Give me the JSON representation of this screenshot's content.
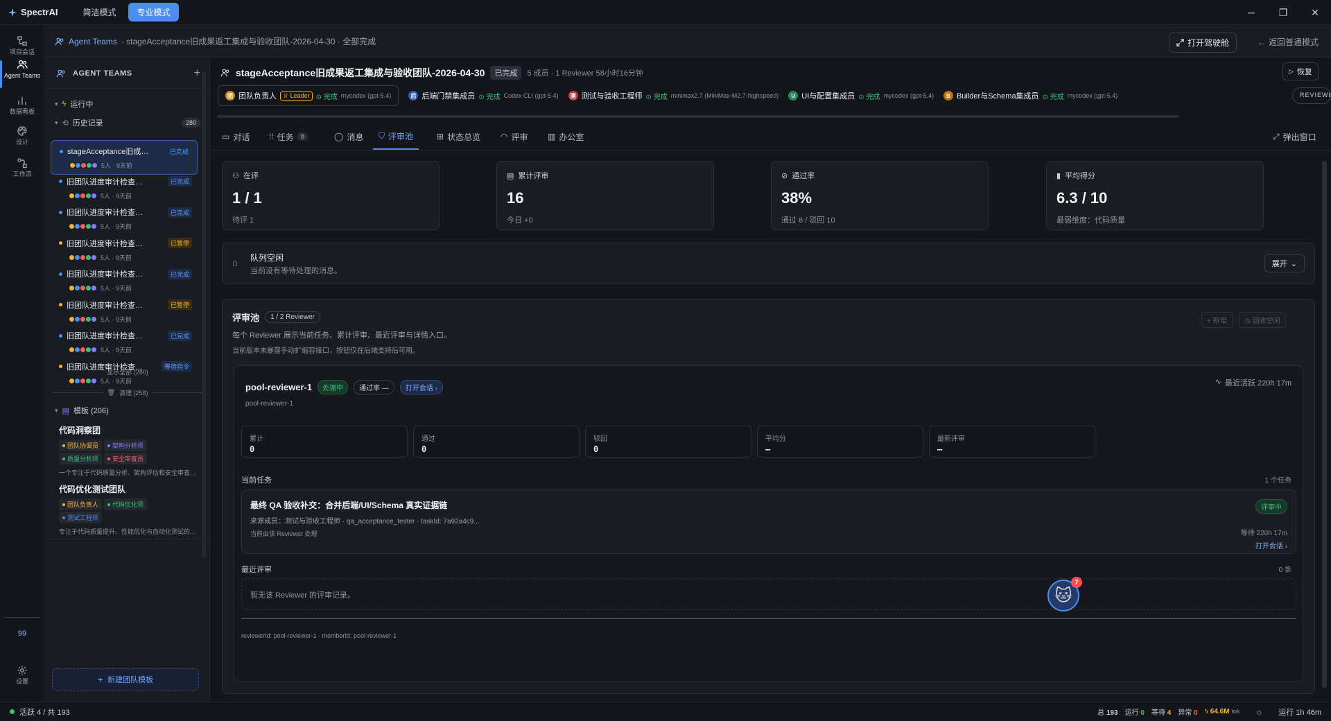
{
  "app": {
    "name": "SpectrAI",
    "modes": [
      "简洁模式",
      "专业模式"
    ]
  },
  "window": {
    "minimize": "─",
    "restore": "❐",
    "close": "✕"
  },
  "rail": {
    "items": [
      {
        "label": "项目会话",
        "icon": "project-tree-icon"
      },
      {
        "label": "Agent Teams",
        "icon": "users-icon"
      },
      {
        "label": "数据看板",
        "icon": "bar-chart-icon"
      },
      {
        "label": "设计",
        "icon": "palette-icon"
      },
      {
        "label": "工作流",
        "icon": "workflow-icon"
      }
    ],
    "count": "99",
    "settings": "设置"
  },
  "breadcrumb": {
    "root": "Agent Teams",
    "rest": "· stageAcceptance旧成果返工集成与验收团队-2026-04-30 · 全部完成"
  },
  "header_actions": {
    "open_cockpit": "打开驾驶舱",
    "back": "返回普通模式"
  },
  "sidebar": {
    "title": "AGENT TEAMS",
    "running": "运行中",
    "history": "历史记录",
    "history_count": "280",
    "items": [
      {
        "name": "stageAcceptance旧成果返工集成与验收团队-2026-04-30",
        "tag": "已完成",
        "kind": "done",
        "meta": "5人 · 9天前",
        "dot": "#4b8ef0"
      },
      {
        "name": "旧团队进度审计检查团队",
        "tag": "已完成",
        "kind": "done",
        "meta": "5人 · 9天前",
        "dot": "#4b8ef0"
      },
      {
        "name": "旧团队进度审计检查团队",
        "tag": "已完成",
        "kind": "done",
        "meta": "5人 · 9天前",
        "dot": "#4b8ef0"
      },
      {
        "name": "旧团队进度审计检查团队",
        "tag": "已暂停",
        "kind": "pause",
        "meta": "5人 · 9天前",
        "dot": "#f5b339"
      },
      {
        "name": "旧团队进度审计检查团队",
        "tag": "已完成",
        "kind": "done",
        "meta": "5人 · 9天前",
        "dot": "#4b8ef0"
      },
      {
        "name": "旧团队进度审计检查团队",
        "tag": "已暂停",
        "kind": "pause",
        "meta": "5人 · 9天前",
        "dot": "#f5b339"
      },
      {
        "name": "旧团队进度审计检查团队",
        "tag": "已完成",
        "kind": "done",
        "meta": "5人 · 9天前",
        "dot": "#4b8ef0"
      },
      {
        "name": "旧团队进度审计检查团队",
        "tag": "等待指令",
        "kind": "wait",
        "meta": "5人 · 9天前",
        "dot": "#f5b339"
      }
    ],
    "show_all": "显示全部 (280)",
    "cleanup": "清理 (258)",
    "templates_label": "模板 (206)",
    "templates": [
      {
        "title": "代码洞察团",
        "roles": [
          {
            "n": "团队协调员",
            "c": "#f5b339"
          },
          {
            "n": "架构分析师",
            "c": "#8b7bff"
          },
          {
            "n": "质量分析师",
            "c": "#39c17e"
          },
          {
            "n": "安全审查员",
            "c": "#ff5c5c"
          }
        ],
        "desc": "一个专注于代码质量分析、架构评估和安全审查的团队"
      },
      {
        "title": "代码优化测试团队",
        "roles": [
          {
            "n": "团队负责人",
            "c": "#f5b339"
          },
          {
            "n": "代码优化师",
            "c": "#39c17e"
          },
          {
            "n": "测试工程师",
            "c": "#4b8ef0"
          }
        ],
        "desc": "专注于代码质量提升、性能优化与自动化测试的团队"
      }
    ],
    "new_template": "新建团队模板"
  },
  "team": {
    "title": "stageAcceptance旧成果返工集成与验收团队-2026-04-30",
    "status": "已完成",
    "summary": "5 成员 · 1 Reviewer 58小时16分钟",
    "restore": "恢复",
    "members": [
      {
        "badge": "团",
        "color": "#c98a16",
        "name": "团队负责人",
        "leader": "Leader",
        "status": "完成",
        "model": "mycodex (gpt-5.4)"
      },
      {
        "badge": "后",
        "color": "#2b5fb5",
        "name": "后端门禁集成员",
        "status": "完成",
        "model": "Codex CLI (gpt-5.4)"
      },
      {
        "badge": "测",
        "color": "#b83a3a",
        "name": "测试与验收工程师",
        "status": "完成",
        "model": "minimax2.7 (MiniMax-M2.7-highspeed)"
      },
      {
        "badge": "U",
        "color": "#1f8a5b",
        "name": "UI与配置集成员",
        "status": "完成",
        "model": "mycodex (gpt-5.4)"
      },
      {
        "badge": "B",
        "color": "#b8760f",
        "name": "Builder与Schema集成员",
        "status": "完成",
        "model": "mycodex (gpt-5.4)"
      }
    ],
    "reviewer_tag": "REVIEWE"
  },
  "tabs": [
    {
      "label": "对话",
      "icon": "chat-icon"
    },
    {
      "label": "任务",
      "icon": "tasks-icon",
      "count": "8"
    },
    {
      "label": "消息",
      "icon": "message-icon"
    },
    {
      "label": "评审池",
      "icon": "shield-check-icon"
    },
    {
      "label": "状态总览",
      "icon": "grid-icon"
    },
    {
      "label": "评审",
      "icon": "gauge-icon"
    },
    {
      "label": "办公室",
      "icon": "building-icon"
    }
  ],
  "popout": "弹出窗口",
  "stats": [
    {
      "label": "在评",
      "value": "1 / 1",
      "sub": "待评 1",
      "icon": "users-icon"
    },
    {
      "label": "累计评审",
      "value": "16",
      "sub": "今日 +0",
      "icon": "clipboard-icon"
    },
    {
      "label": "通过率",
      "value": "38%",
      "sub": "通过 6 / 驳回 10",
      "icon": "check-circle-icon"
    },
    {
      "label": "平均得分",
      "value": "6.3 / 10",
      "sub": "最弱维度：代码质量",
      "icon": "bar-chart-icon"
    }
  ],
  "queue": {
    "title": "队列空闲",
    "desc": "当前没有等待处理的消息。",
    "expand": "展开"
  },
  "pool": {
    "title": "评审池",
    "badge": "1 / 2 Reviewer",
    "desc1": "每个 Reviewer 展示当前任务、累计评审、最近评审与详情入口。",
    "desc2": "当前版本未暴露手动扩缩容接口，按钮仅在后端支持后可用。",
    "add": "新增",
    "reclaim": "回收空闲"
  },
  "reviewer": {
    "name": "pool-reviewer-1",
    "state": "处理中",
    "pass_rate": "通过率 —",
    "open_session": "打开会话",
    "id": "pool-reviewer-1",
    "last_active": "最近活跃 220h 17m",
    "metrics": [
      {
        "label": "累计",
        "value": "0"
      },
      {
        "label": "通过",
        "value": "0"
      },
      {
        "label": "驳回",
        "value": "0"
      },
      {
        "label": "平均分",
        "value": "—"
      },
      {
        "label": "最新评审",
        "value": "—"
      }
    ],
    "current_task_label": "当前任务",
    "task_count": "1 个任务",
    "task": {
      "title": "最终 QA 验收补交：合并后端/UI/Schema 真实证据链",
      "source": "来源成员：测试与验收工程师 · qa_acceptance_tester · taskId: 7a92a4c9...",
      "handler": "当前由该 Reviewer 处理",
      "state": "评审中",
      "wait": "等待 220h 17m",
      "open": "打开会话"
    },
    "recent_label": "最近评审",
    "recent_count": "0 条",
    "recent_empty": "暂无该 Reviewer 的评审记录。",
    "footer": "reviewerId: pool-reviewer-1 · memberId: pool-reviewer-1"
  },
  "mascot": {
    "emoji": "🐱",
    "badge": "7"
  },
  "status": {
    "active": "活跃 4 / 共 193",
    "total_label": "总",
    "total": "193",
    "running_label": "运行",
    "running": "0",
    "waiting_label": "等待",
    "waiting": "4",
    "error_label": "异常",
    "error": "0",
    "tokens": "64.6M",
    "tokens_unit": "tok",
    "uptime": "运行 1h 46m"
  },
  "colors": {
    "accent": "#4b8ef0",
    "success": "#39c17e",
    "warning": "#f5b339",
    "danger": "#ff5c5c"
  }
}
